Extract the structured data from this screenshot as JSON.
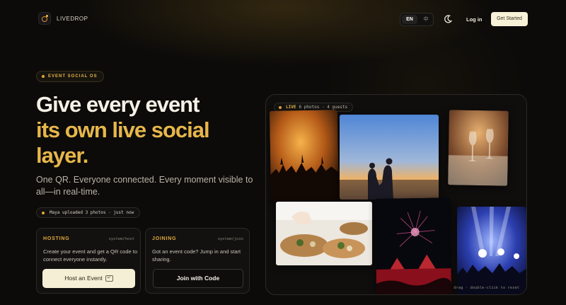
{
  "nav": {
    "brand": "LIVEDROP",
    "lang_en": "EN",
    "lang_zh": "中",
    "login": "Log in",
    "get_started": "Get Started"
  },
  "hero": {
    "eyebrow": "EVENT SOCIAL OS",
    "title_line1": "Give every event",
    "title_line2": "its own live social",
    "title_line3": "layer.",
    "subtitle": "One QR. Everyone connected. Every moment visible to all—in real-time.",
    "activity": "Maya uploaded 3 photos · just now"
  },
  "cards": {
    "hosting": {
      "tag": "HOSTING",
      "path": "system/host",
      "desc": "Create your event and get a QR code to connect everyone instantly.",
      "button": "Host an Event",
      "kbd": "↵"
    },
    "joining": {
      "tag": "JOINING",
      "path": "system/join",
      "desc": "Got an event code? Jump in and start sharing.",
      "button": "Join with Code"
    }
  },
  "board": {
    "live_label": "LIVE",
    "live_stats": "6 photos · 4 guests",
    "hint": "drag · double-click to reset",
    "photos": [
      "concert-crowd-sunset",
      "couple-beach-sunset",
      "wine-dinner-table",
      "plated-food-chef",
      "fireworks-stage",
      "concert-stage-lights"
    ]
  },
  "colors": {
    "accent": "#e7b74a",
    "background": "#0c0b09",
    "button_light": "#f5efd6"
  }
}
